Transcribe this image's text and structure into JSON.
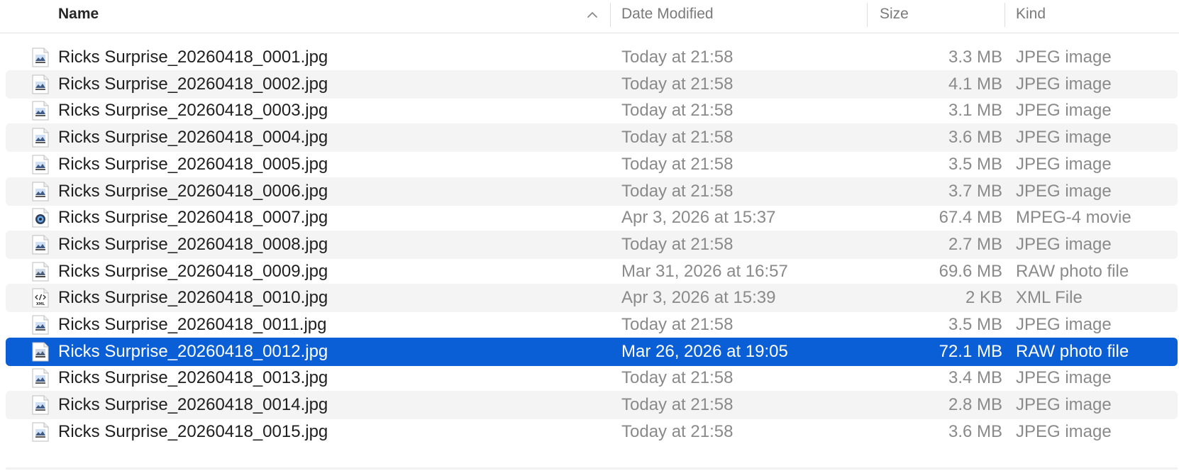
{
  "columns": {
    "name": "Name",
    "date": "Date Modified",
    "size": "Size",
    "kind": "Kind",
    "sort_icon": "chevron-up-icon"
  },
  "files": [
    {
      "name": "Ricks Surprise_20260418_0001.jpg",
      "date": "Today at 21:58",
      "size": "3.3 MB",
      "kind": "JPEG image",
      "icon": "jpeg-file-icon",
      "selected": false
    },
    {
      "name": "Ricks Surprise_20260418_0002.jpg",
      "date": "Today at 21:58",
      "size": "4.1 MB",
      "kind": "JPEG image",
      "icon": "jpeg-file-icon",
      "selected": false
    },
    {
      "name": "Ricks Surprise_20260418_0003.jpg",
      "date": "Today at 21:58",
      "size": "3.1 MB",
      "kind": "JPEG image",
      "icon": "jpeg-file-icon",
      "selected": false
    },
    {
      "name": "Ricks Surprise_20260418_0004.jpg",
      "date": "Today at 21:58",
      "size": "3.6 MB",
      "kind": "JPEG image",
      "icon": "jpeg-file-icon",
      "selected": false
    },
    {
      "name": "Ricks Surprise_20260418_0005.jpg",
      "date": "Today at 21:58",
      "size": "3.5 MB",
      "kind": "JPEG image",
      "icon": "jpeg-file-icon",
      "selected": false
    },
    {
      "name": "Ricks Surprise_20260418_0006.jpg",
      "date": "Today at 21:58",
      "size": "3.7 MB",
      "kind": "JPEG image",
      "icon": "jpeg-file-icon",
      "selected": false
    },
    {
      "name": "Ricks Surprise_20260418_0007.jpg",
      "date": "Apr 3, 2026 at 15:37",
      "size": "67.4 MB",
      "kind": "MPEG-4 movie",
      "icon": "movie-file-icon",
      "selected": false
    },
    {
      "name": "Ricks Surprise_20260418_0008.jpg",
      "date": "Today at 21:58",
      "size": "2.7 MB",
      "kind": "JPEG image",
      "icon": "jpeg-file-icon",
      "selected": false
    },
    {
      "name": "Ricks Surprise_20260418_0009.jpg",
      "date": "Mar 31, 2026 at 16:57",
      "size": "69.6 MB",
      "kind": "RAW photo file",
      "icon": "raw-file-icon",
      "selected": false
    },
    {
      "name": "Ricks Surprise_20260418_0010.jpg",
      "date": "Apr 3, 2026 at 15:39",
      "size": "2 KB",
      "kind": "XML File",
      "icon": "xml-file-icon",
      "selected": false
    },
    {
      "name": "Ricks Surprise_20260418_0011.jpg",
      "date": "Today at 21:58",
      "size": "3.5 MB",
      "kind": "JPEG image",
      "icon": "jpeg-file-icon",
      "selected": false
    },
    {
      "name": "Ricks Surprise_20260418_0012.jpg",
      "date": "Mar 26, 2026 at 19:05",
      "size": "72.1 MB",
      "kind": "RAW photo file",
      "icon": "raw-file-icon",
      "selected": true
    },
    {
      "name": "Ricks Surprise_20260418_0013.jpg",
      "date": "Today at 21:58",
      "size": "3.4 MB",
      "kind": "JPEG image",
      "icon": "jpeg-file-icon",
      "selected": false
    },
    {
      "name": "Ricks Surprise_20260418_0014.jpg",
      "date": "Today at 21:58",
      "size": "2.8 MB",
      "kind": "JPEG image",
      "icon": "jpeg-file-icon",
      "selected": false
    },
    {
      "name": "Ricks Surprise_20260418_0015.jpg",
      "date": "Today at 21:58",
      "size": "3.6 MB",
      "kind": "JPEG image",
      "icon": "jpeg-file-icon",
      "selected": false
    }
  ],
  "colors": {
    "selection": "#0b5fd6",
    "alt_row": "#f4f4f5"
  }
}
